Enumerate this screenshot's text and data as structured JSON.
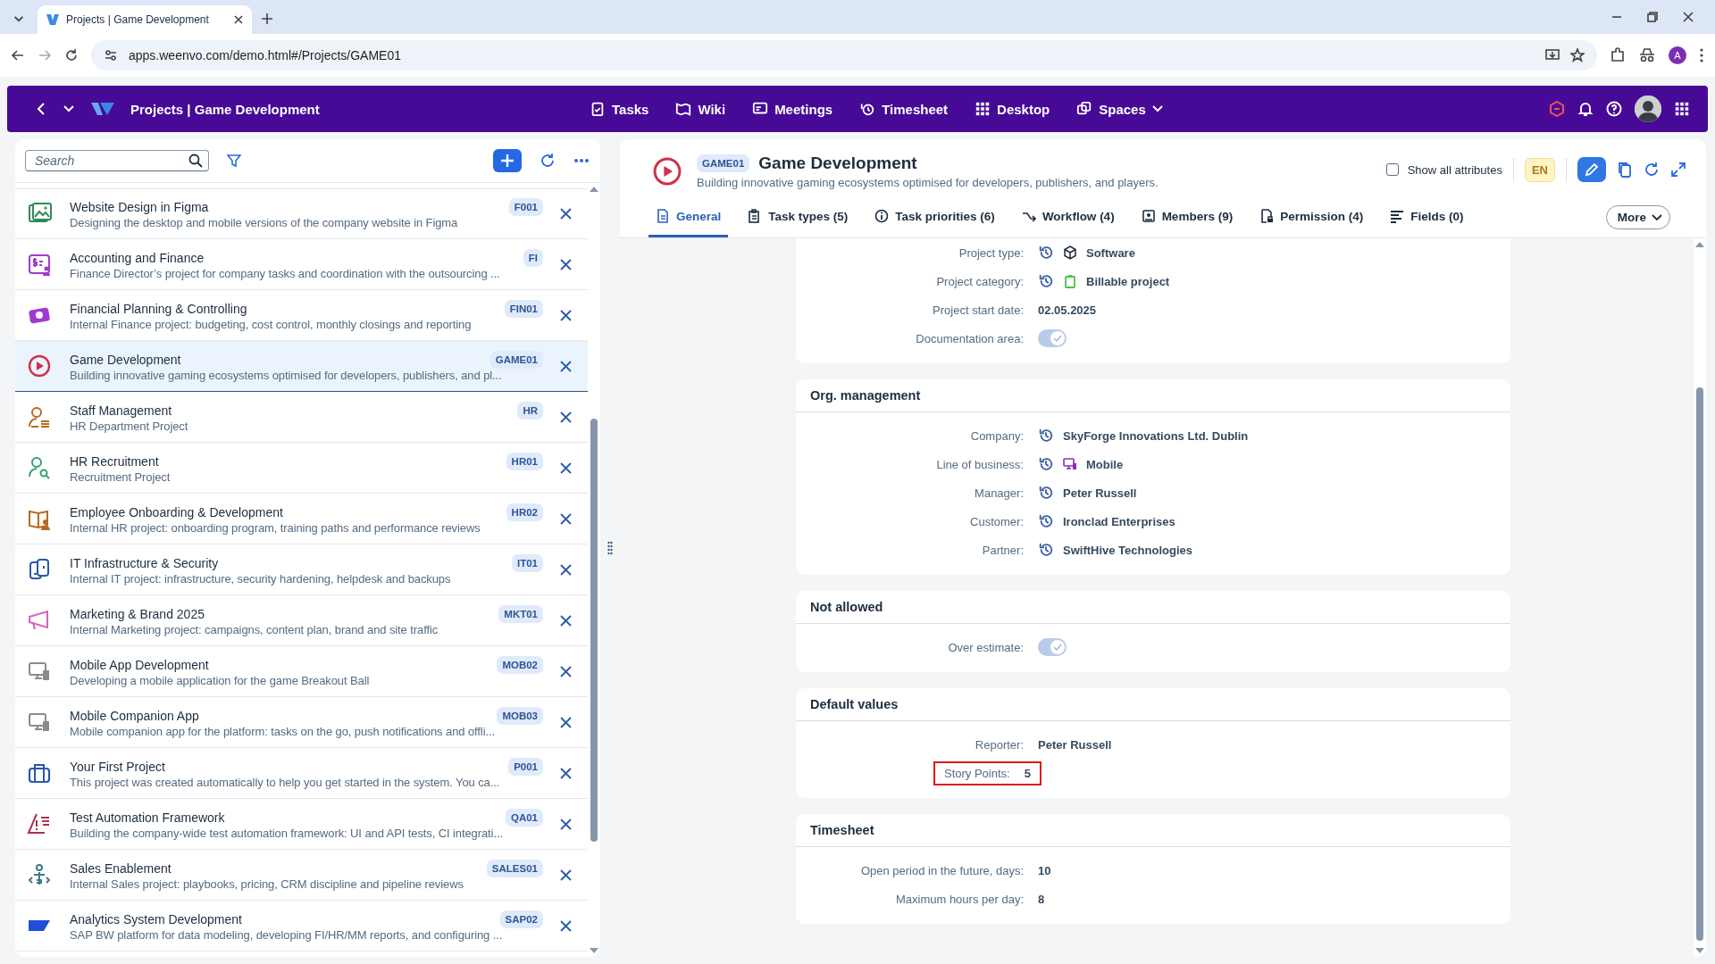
{
  "browser": {
    "tab_title": "Projects | Game Development",
    "url": "apps.weenvo.com/demo.html#/Projects/GAME01",
    "profile_initial": "A"
  },
  "app_header": {
    "title": "Projects | Game Development",
    "nav": [
      {
        "label": "Tasks",
        "dropdown": false
      },
      {
        "label": "Wiki",
        "dropdown": false
      },
      {
        "label": "Meetings",
        "dropdown": false
      },
      {
        "label": "Timesheet",
        "dropdown": false
      },
      {
        "label": "Desktop",
        "dropdown": false
      },
      {
        "label": "Spaces",
        "dropdown": true
      }
    ]
  },
  "sidebar": {
    "search": {
      "placeholder": "Search"
    },
    "projects": [
      {
        "title": "Website Design in Figma",
        "description": "Designing the desktop and mobile versions of the company website in Figma",
        "code": "F001",
        "selected": false
      },
      {
        "title": "Accounting and Finance",
        "description": "Finance Director’s project for company tasks and coordination with the outsourcing ...",
        "code": "FI",
        "selected": false
      },
      {
        "title": "Financial Planning & Controlling",
        "description": "Internal Finance project: budgeting, cost control, monthly closings and reporting",
        "code": "FIN01",
        "selected": false
      },
      {
        "title": "Game Development",
        "description": "Building innovative gaming ecosystems optimised for developers, publishers, and pl...",
        "code": "GAME01",
        "selected": true
      },
      {
        "title": "Staff Management",
        "description": "HR Department Project",
        "code": "HR",
        "selected": false
      },
      {
        "title": "HR Recruitment",
        "description": "Recruitment Project",
        "code": "HR01",
        "selected": false
      },
      {
        "title": "Employee Onboarding & Development",
        "description": "Internal HR project: onboarding program, training paths and performance reviews",
        "code": "HR02",
        "selected": false
      },
      {
        "title": "IT Infrastructure & Security",
        "description": "Internal IT project: infrastructure, security hardening, helpdesk and backups",
        "code": "IT01",
        "selected": false
      },
      {
        "title": "Marketing & Brand 2025",
        "description": "Internal Marketing project: campaigns, content plan, brand and site traffic",
        "code": "MKT01",
        "selected": false
      },
      {
        "title": "Mobile App Development",
        "description": "Developing a mobile application for the game Breakout Ball",
        "code": "MOB02",
        "selected": false
      },
      {
        "title": "Mobile Companion App",
        "description": "Mobile companion app for the platform: tasks on the go, push notifications and offli...",
        "code": "MOB03",
        "selected": false
      },
      {
        "title": "Your First Project",
        "description": "This project was created automatically to help you get started in the system. You ca...",
        "code": "P001",
        "selected": false
      },
      {
        "title": "Test Automation Framework",
        "description": "Building the company-wide test automation framework: UI and API tests, CI integrati...",
        "code": "QA01",
        "selected": false
      },
      {
        "title": "Sales Enablement",
        "description": "Internal Sales project: playbooks, pricing, CRM discipline and pipeline reviews",
        "code": "SALES01",
        "selected": false
      },
      {
        "title": "Analytics System Development",
        "description": "SAP BW platform for data modeling, developing FI/HR/MM reports, and configuring ...",
        "code": "SAP02",
        "selected": false
      }
    ]
  },
  "detail": {
    "code": "GAME01",
    "title": "Game Development",
    "subtitle": "Building innovative gaming ecosystems optimised for developers, publishers, and players.",
    "show_all_attributes": {
      "label": "Show all attributes",
      "checked": false
    },
    "language": "EN",
    "tabs": [
      {
        "label": "General",
        "selected": true
      },
      {
        "label": "Task types (5)",
        "selected": false
      },
      {
        "label": "Task priorities (6)",
        "selected": false
      },
      {
        "label": "Workflow (4)",
        "selected": false
      },
      {
        "label": "Members (9)",
        "selected": false
      },
      {
        "label": "Permission (4)",
        "selected": false
      },
      {
        "label": "Fields (0)",
        "selected": false
      }
    ],
    "more": "More",
    "sections": [
      {
        "fields": [
          {
            "kind": "text",
            "label": "Project type:",
            "value": "Software",
            "history": true,
            "highlighted": false
          },
          {
            "kind": "text",
            "label": "Project category:",
            "value": "Billable project",
            "history": true,
            "highlighted": false
          },
          {
            "kind": "text",
            "label": "Project start date:",
            "value": "02.05.2025",
            "history": false,
            "highlighted": false
          },
          {
            "kind": "toggle",
            "label": "Documentation area:",
            "on": true,
            "history": false,
            "highlighted": false
          }
        ]
      },
      {
        "title": "Org. management",
        "fields": [
          {
            "kind": "text",
            "label": "Company:",
            "value": "SkyForge Innovations Ltd. Dublin",
            "history": true,
            "highlighted": false
          },
          {
            "kind": "text",
            "label": "Line of business:",
            "value": "Mobile",
            "history": true,
            "highlighted": false
          },
          {
            "kind": "text",
            "label": "Manager:",
            "value": "Peter Russell",
            "history": true,
            "highlighted": false
          },
          {
            "kind": "text",
            "label": "Customer:",
            "value": "Ironclad Enterprises",
            "history": true,
            "highlighted": false
          },
          {
            "kind": "text",
            "label": "Partner:",
            "value": "SwiftHive Technologies",
            "history": true,
            "highlighted": false
          }
        ]
      },
      {
        "title": "Not allowed",
        "fields": [
          {
            "kind": "toggle",
            "label": "Over estimate:",
            "on": true,
            "history": false,
            "highlighted": false
          }
        ]
      },
      {
        "title": "Default values",
        "fields": [
          {
            "kind": "text",
            "label": "Reporter:",
            "value": "Peter Russell",
            "history": false,
            "highlighted": false
          },
          {
            "kind": "text",
            "label": "Story Points:",
            "value": "5",
            "history": false,
            "highlighted": true
          }
        ]
      },
      {
        "title": "Timesheet",
        "fields": [
          {
            "kind": "text",
            "label": "Open period in the future, days:",
            "value": "10",
            "history": false,
            "highlighted": false
          },
          {
            "kind": "text",
            "label": "Maximum hours per day:",
            "value": "8",
            "history": false,
            "highlighted": false
          }
        ]
      }
    ]
  }
}
